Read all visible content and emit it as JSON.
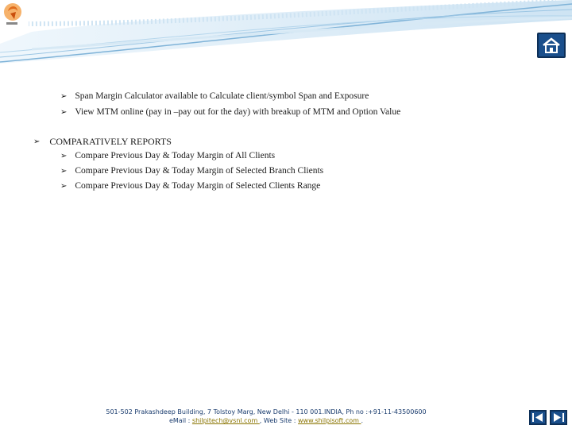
{
  "content": {
    "sub_items_top": [
      "Span Margin Calculator available to Calculate client/symbol Span and Exposure",
      "View MTM online (pay in –pay out for the day) with breakup of  MTM and Option Value"
    ],
    "section_title": "COMPARATIVELY REPORTS",
    "section_items": [
      "Compare Previous Day & Today Margin of All Clients",
      "Compare Previous Day & Today Margin of Selected Branch Clients",
      "Compare Previous Day & Today Margin of Selected Clients Range"
    ]
  },
  "footer": {
    "address": "501-502 Prakashdeep Building, 7 Tolstoy Marg, New Delhi - 110 001.INDIA,  Ph no :+91-11-43500600",
    "email_label": "eMail : ",
    "email": "shilpitech@vsnl.com ",
    "web_label": " , Web Site : ",
    "website": " www.shilpisoft.com ",
    "tail": " ."
  },
  "icons": {
    "bullet": "arrow-bullet-icon",
    "home": "home-icon",
    "prev": "prev-slide-icon",
    "next": "next-slide-icon",
    "logo": "logo-icon"
  },
  "colors": {
    "accent": "#1a4f8c",
    "header_wave": "#7fb3d8",
    "footer_text": "#1a3c6e",
    "footer_link": "#8a7400"
  }
}
